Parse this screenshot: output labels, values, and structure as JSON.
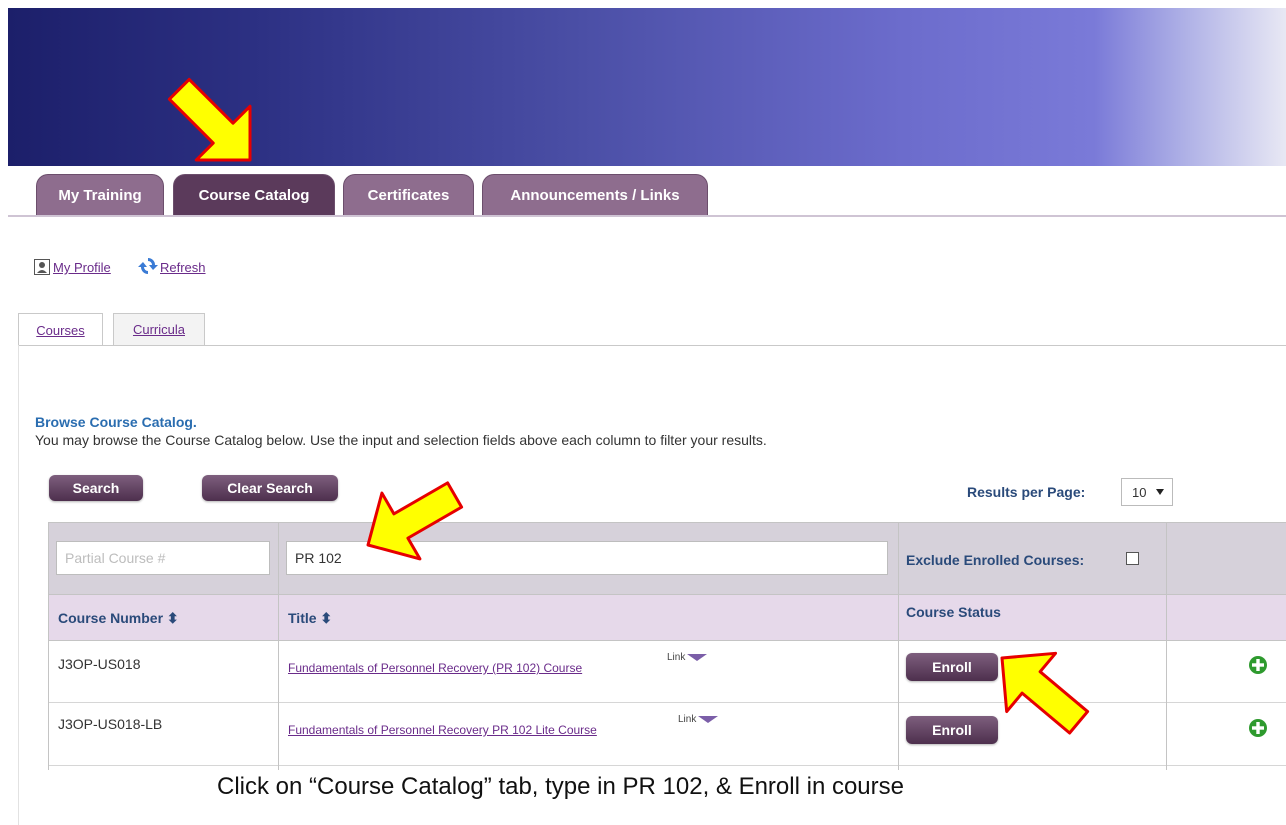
{
  "main_tabs": [
    {
      "label": "My Training",
      "active": false
    },
    {
      "label": "Course Catalog",
      "active": true
    },
    {
      "label": "Certificates",
      "active": false
    },
    {
      "label": "Announcements / Links",
      "active": false
    }
  ],
  "profile_links": {
    "my_profile": "My Profile",
    "refresh": "Refresh"
  },
  "sub_tabs": [
    {
      "label": "Courses",
      "active": true
    },
    {
      "label": "Curricula",
      "active": false
    }
  ],
  "browse": {
    "title": "Browse Course Catalog.",
    "description": "You may browse the Course Catalog below. Use the input and selection fields above each column to filter your results."
  },
  "buttons": {
    "search": "Search",
    "clear_search": "Clear Search",
    "enroll": "Enroll"
  },
  "results_per_page": {
    "label": "Results per Page:",
    "value": "10"
  },
  "filters": {
    "course_number_placeholder": "Partial Course #",
    "title_value": "PR 102",
    "exclude_enrolled_label": "Exclude Enrolled Courses:",
    "exclude_enrolled_checked": false
  },
  "columns": {
    "course_number": "Course Number ⬍",
    "title": "Title ⬍",
    "course_status": "Course Status"
  },
  "rows": [
    {
      "course_number": "J3OP-US018",
      "title": "Fundamentals of Personnel Recovery (PR 102) Course",
      "link_label": "Link"
    },
    {
      "course_number": "J3OP-US018-LB",
      "title": "Fundamentals of Personnel Recovery PR 102 Lite Course",
      "link_label": "Link"
    }
  ],
  "caption": "Click on “Course Catalog” tab, type in PR 102, & Enroll in course",
  "colors": {
    "tab_inactive": "#8e6d8e",
    "tab_active": "#5b3a5b",
    "header_blue": "#2a4a7a",
    "link_purple": "#6a2b8a",
    "arrow_fill": "#ffff00",
    "arrow_stroke": "#e60000",
    "plus_green": "#2e9a2e"
  }
}
